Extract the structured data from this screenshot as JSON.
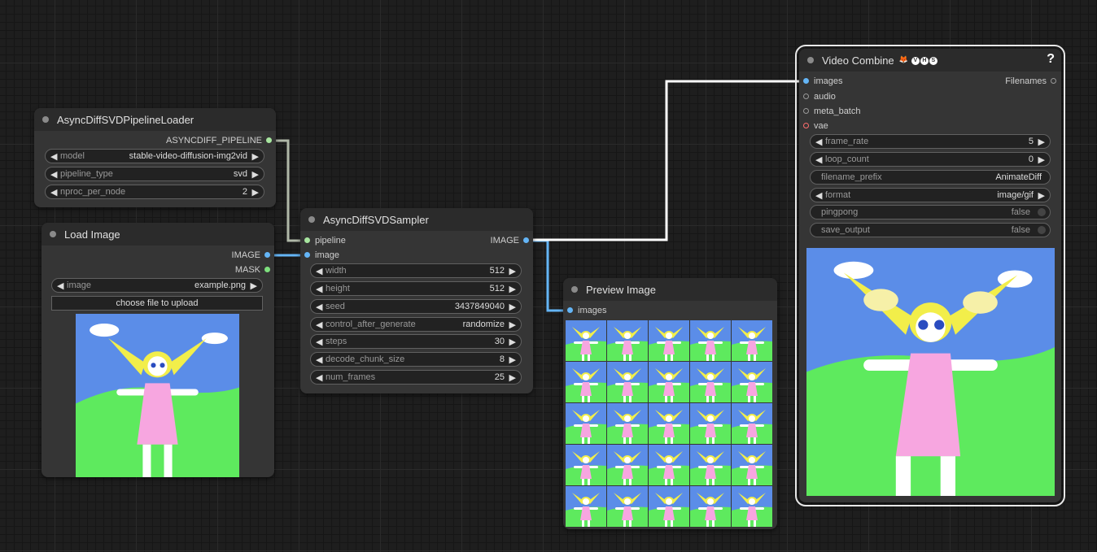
{
  "nodes": {
    "pipeline_loader": {
      "title": "AsyncDiffSVDPipelineLoader",
      "output": "ASYNCDIFF_PIPELINE",
      "widgets": [
        {
          "label": "model",
          "value": "stable-video-diffusion-img2vid"
        },
        {
          "label": "pipeline_type",
          "value": "svd"
        },
        {
          "label": "nproc_per_node",
          "value": "2"
        }
      ]
    },
    "load_image": {
      "title": "Load Image",
      "outputs": [
        "IMAGE",
        "MASK"
      ],
      "image_widget": {
        "label": "image",
        "value": "example.png"
      },
      "upload_button": "choose file to upload"
    },
    "sampler": {
      "title": "AsyncDiffSVDSampler",
      "inputs": [
        "pipeline",
        "image"
      ],
      "output": "IMAGE",
      "widgets": [
        {
          "label": "width",
          "value": "512"
        },
        {
          "label": "height",
          "value": "512"
        },
        {
          "label": "seed",
          "value": "3437849040"
        },
        {
          "label": "control_after_generate",
          "value": "randomize"
        },
        {
          "label": "steps",
          "value": "30"
        },
        {
          "label": "decode_chunk_size",
          "value": "8"
        },
        {
          "label": "num_frames",
          "value": "25"
        }
      ]
    },
    "preview": {
      "title": "Preview Image",
      "input": "images"
    },
    "video_combine": {
      "title": "Video Combine",
      "badge_letters": [
        "V",
        "H",
        "S"
      ],
      "help": "?",
      "inputs": [
        "images",
        "audio",
        "meta_batch",
        "vae"
      ],
      "output": "Filenames",
      "widgets": [
        {
          "label": "frame_rate",
          "value": "5"
        },
        {
          "label": "loop_count",
          "value": "0"
        },
        {
          "label": "filename_prefix",
          "value": "AnimateDiff"
        },
        {
          "label": "format",
          "value": "image/gif"
        },
        {
          "label": "pingpong",
          "value": "false"
        },
        {
          "label": "save_output",
          "value": "false"
        }
      ]
    }
  },
  "colors": {
    "link_pipeline": "#b0b8a8",
    "link_image": "#64b5f6",
    "link_white": "#ffffff",
    "pin_pipeline": "#a8e6a0",
    "pin_image": "#64b5f6",
    "pin_mask": "#7ee07e",
    "pin_vae": "#ff6e6e",
    "sky": "#5b8de8",
    "grass": "#5eea5e",
    "dress": "#f7a6e0",
    "hair": "#f2ee4a"
  }
}
